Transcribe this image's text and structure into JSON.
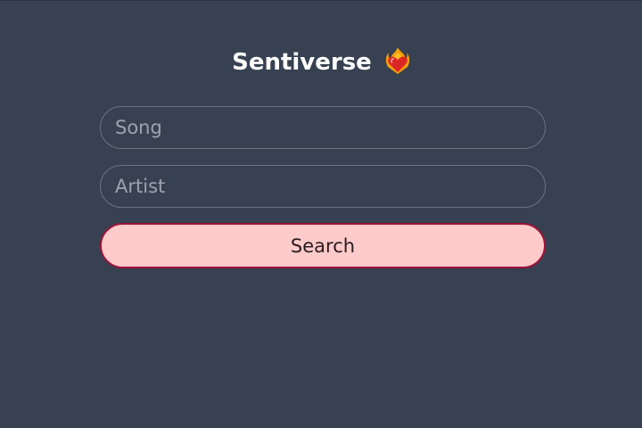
{
  "app": {
    "title": "Sentiverse",
    "logo_icon": "heart-on-fire-icon"
  },
  "form": {
    "song": {
      "placeholder": "Song",
      "value": ""
    },
    "artist": {
      "placeholder": "Artist",
      "value": ""
    },
    "search_label": "Search"
  },
  "colors": {
    "background": "#374151",
    "field_border": "#6b7280",
    "placeholder": "#9ca3af",
    "button_fill": "#fecaca",
    "button_border": "#9f1239"
  }
}
